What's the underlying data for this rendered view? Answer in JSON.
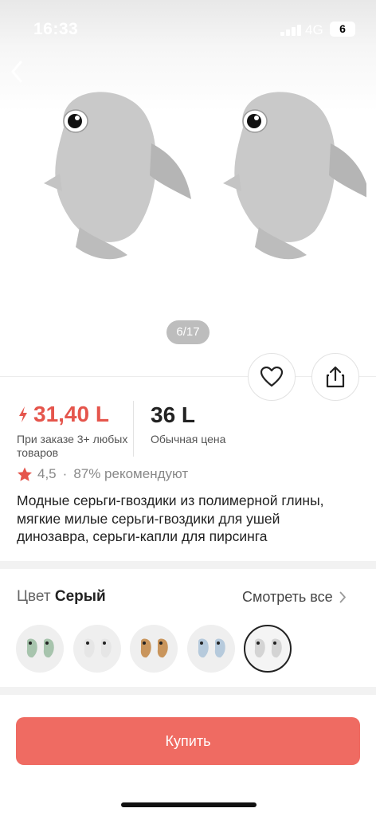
{
  "status_bar": {
    "time": "16:33",
    "network": "4G",
    "battery": "6"
  },
  "gallery": {
    "counter": "6/17"
  },
  "price": {
    "sale_price": "31,40 L",
    "sale_note": "При заказе 3+ любых товаров",
    "regular_price": "36 L",
    "regular_note": "Обычная цена"
  },
  "rating": {
    "value": "4,5",
    "separator": "·",
    "recommend": "87% рекомендуют"
  },
  "product": {
    "title": "Модные серьги-гвоздики из полимерной глины, мягкие милые серьги-гвоздики для ушей динозавра, серьги-капли для пирсинга"
  },
  "color": {
    "label": "Цвет",
    "selected": "Серый",
    "see_all": "Смотреть все",
    "swatches": [
      {
        "name": "green",
        "color": "#a7c4ad"
      },
      {
        "name": "white-black",
        "color": "#e6e6e6"
      },
      {
        "name": "brown",
        "color": "#c9955c"
      },
      {
        "name": "light-blue",
        "color": "#b6cadc"
      },
      {
        "name": "gray",
        "color": "#d4d4d4"
      }
    ]
  },
  "buy_button": {
    "label": "Купить"
  },
  "colors": {
    "accent": "#ef6b62",
    "price_red": "#e5554c",
    "star": "#e5554c"
  }
}
